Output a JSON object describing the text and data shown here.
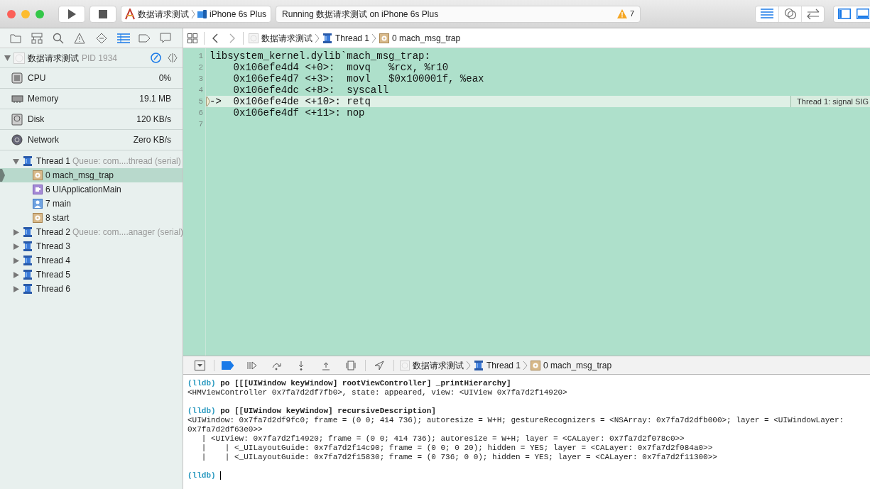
{
  "toolbar": {
    "scheme": "数据请求测试",
    "device": "iPhone 6s Plus",
    "status": "Running 数据请求测试 on iPhone 6s Plus",
    "warning_count": "7"
  },
  "navigator_tabs": [
    {
      "selected": false
    },
    {
      "selected": false
    },
    {
      "selected": false
    },
    {
      "selected": false
    },
    {
      "selected": false
    },
    {
      "selected": true
    },
    {
      "selected": false
    },
    {
      "selected": false
    }
  ],
  "process": {
    "name": "数据请求测试",
    "pid": "PID 1934",
    "expanded": true
  },
  "gauges": [
    {
      "kind": "cpu",
      "label": "CPU",
      "value": "0%"
    },
    {
      "kind": "memory",
      "label": "Memory",
      "value": "19.1 MB"
    },
    {
      "kind": "disk",
      "label": "Disk",
      "value": "120 KB/s"
    },
    {
      "kind": "network",
      "label": "Network",
      "value": "Zero KB/s"
    }
  ],
  "threads": [
    {
      "name": "Thread 1",
      "queue": "Queue: com....thread (serial)",
      "expanded": true,
      "children": [
        {
          "kind": "gear",
          "label": "0 mach_msg_trap",
          "selected": true
        },
        {
          "kind": "framework",
          "label": "6 UIApplicationMain",
          "selected": false
        },
        {
          "kind": "user",
          "label": "7 main",
          "selected": false
        },
        {
          "kind": "gear",
          "label": "8 start",
          "selected": false
        }
      ]
    },
    {
      "name": "Thread 2",
      "queue": "Queue: com....anager (serial)",
      "expanded": false
    },
    {
      "name": "Thread 3",
      "expanded": false
    },
    {
      "name": "Thread 4",
      "expanded": false
    },
    {
      "name": "Thread 5",
      "expanded": false
    },
    {
      "name": "Thread 6",
      "expanded": false
    }
  ],
  "jump_bar": [
    "数据请求测试",
    "Thread 1",
    "0 mach_msg_trap"
  ],
  "editor": {
    "annotation": "Thread 1: signal SIG",
    "lines": [
      {
        "number": "1",
        "text": "libsystem_kernel.dylib`mach_msg_trap:",
        "current": false
      },
      {
        "number": "2",
        "text": "    0x106efe4d4 <+0>:  movq   %rcx, %r10",
        "current": false
      },
      {
        "number": "3",
        "text": "    0x106efe4d7 <+3>:  movl   $0x100001f, %eax",
        "current": false
      },
      {
        "number": "4",
        "text": "    0x106efe4dc <+8>:  syscall",
        "current": false
      },
      {
        "number": "5",
        "text": "->  0x106efe4de <+10>: retq",
        "current": true
      },
      {
        "number": "6",
        "text": "    0x106efe4df <+11>: nop",
        "current": false
      },
      {
        "number": "7",
        "current": false
      }
    ]
  },
  "debug_bar": {
    "breakpoints_active": true,
    "jump_bar": [
      "数据请求测试",
      "Thread 1",
      "0 mach_msg_trap"
    ]
  },
  "console": [
    {
      "kind": "command",
      "prompt": "(lldb)",
      "text": "po [[[UIWindow keyWindow] rootViewController] _printHierarchy]"
    },
    {
      "kind": "output",
      "text": "<HMViewController 0x7fa7d2df7fb0>, state: appeared, view: <UIView 0x7fa7d2f14920>"
    },
    {
      "kind": "command",
      "prompt": "(lldb)",
      "text": "po [[UIWindow keyWindow] recursiveDescription]"
    },
    {
      "kind": "output",
      "text": "<UIWindow: 0x7fa7d2df9fc0; frame = (0 0; 414 736); autoresize = W+H; gestureRecognizers = <NSArray: 0x7fa7d2dfb000>; layer = <UIWindowLayer:"
    },
    {
      "kind": "output",
      "text": "0x7fa7d2df63e0>>"
    },
    {
      "kind": "output",
      "text": "   | <UIView: 0x7fa7d2f14920; frame = (0 0; 414 736); autoresize = W+H; layer = <CALayer: 0x7fa7d2f078c0>>"
    },
    {
      "kind": "output",
      "text": "   |    | <_UILayoutGuide: 0x7fa7d2f14c90; frame = (0 0; 0 20); hidden = YES; layer = <CALayer: 0x7fa7d2f084a0>>"
    },
    {
      "kind": "output",
      "text": "   |    | <_UILayoutGuide: 0x7fa7d2f15830; frame = (0 736; 0 0); hidden = YES; layer = <CALayer: 0x7fa7d2f11300>>"
    },
    {
      "kind": "input",
      "prompt": "(lldb)"
    }
  ]
}
